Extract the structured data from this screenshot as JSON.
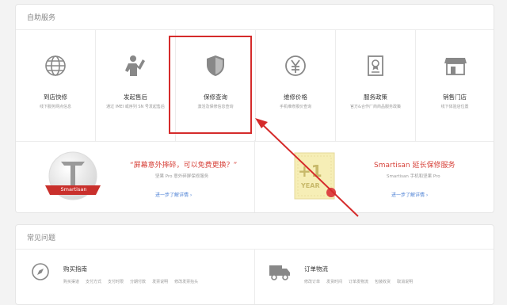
{
  "self_service": {
    "title": "自助服务",
    "items": [
      {
        "title": "到店快修",
        "subtitle": "线下服务网点信息",
        "icon": "globe-icon"
      },
      {
        "title": "发起售后",
        "subtitle": "通过 IMEI 或序列 SN 号发起售后",
        "icon": "person-wave-icon"
      },
      {
        "title": "保修查询",
        "subtitle": "激活及保修信息查询",
        "icon": "shield-icon"
      },
      {
        "title": "维修价格",
        "subtitle": "手机维修报价查询",
        "icon": "yen-coin-icon"
      },
      {
        "title": "服务政策",
        "subtitle": "官方&合作厂商商品服务政策",
        "icon": "document-badge-icon"
      },
      {
        "title": "销售门店",
        "subtitle": "线下体验店位置",
        "icon": "storefront-icon"
      }
    ]
  },
  "promos": [
    {
      "title": "“屏幕意外摔碎，可以免费更换？”",
      "subtitle": "坚果 Pro 意外碎屏保修服务",
      "link": "进一步了解详情 ›",
      "badge_text": "Smartisan"
    },
    {
      "title": "Smartisan 延长保修服务",
      "subtitle": "Smartisan 手机和坚果 Pro",
      "link": "进一步了解详情 ›",
      "badge_big": "+1",
      "badge_small": "YEAR"
    }
  ],
  "faq": {
    "title": "常见问题",
    "items": [
      {
        "title": "购买指南",
        "links": [
          "购买渠道",
          "支付方式",
          "支付时限",
          "分期付款",
          "发票说明",
          "修改发票抬头"
        ],
        "icon": "compass-icon"
      },
      {
        "title": "订单物流",
        "links": [
          "修改订单",
          "发货时间",
          "订单发物流",
          "包装收货",
          "取消说明"
        ],
        "icon": "truck-icon"
      }
    ]
  },
  "colors": {
    "accent": "#d7433b",
    "link": "#4a7fd4",
    "highlight": "#d52b2b"
  }
}
